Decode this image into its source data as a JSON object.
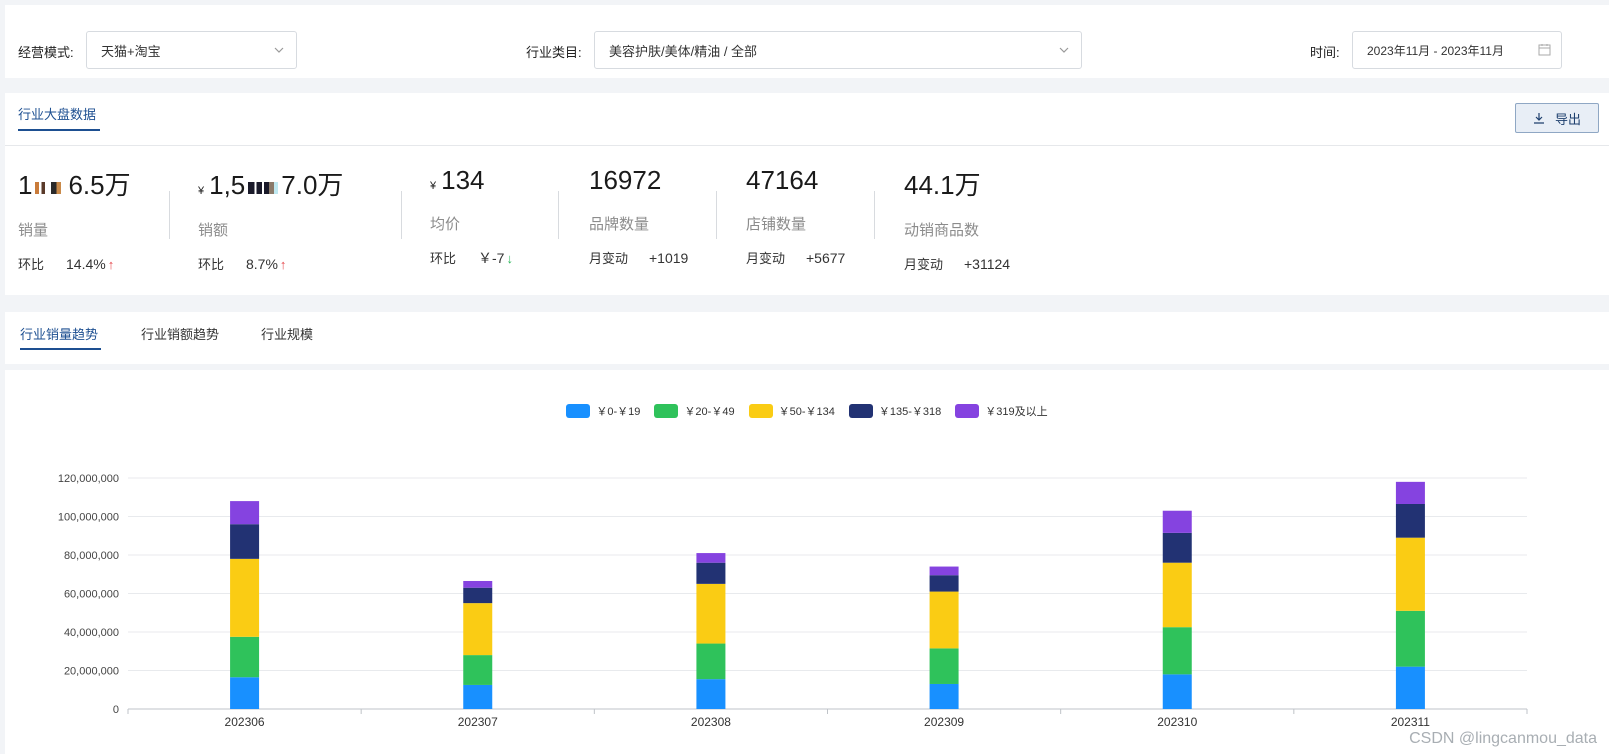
{
  "filters": {
    "mode_label": "经营模式:",
    "mode_value": "天猫+淘宝",
    "category_label": "行业类目:",
    "category_value": "美容护肤/美体/精油 / 全部",
    "time_label": "时间:",
    "time_value": "2023年11月 - 2023年11月"
  },
  "overview": {
    "tab": "行业大盘数据",
    "export_label": "导出",
    "metrics": [
      {
        "value_pre": "1",
        "value_post": "6.5万",
        "name": "销量",
        "sub_key": "环比",
        "sub_val": "14.4%",
        "trend": "up"
      },
      {
        "yen": "¥",
        "value_pre": "1,5",
        "value_post": "7.0万",
        "name": "销额",
        "sub_key": "环比",
        "sub_val": "8.7%",
        "trend": "up"
      },
      {
        "yen": "¥",
        "value": "134",
        "name": "均价",
        "sub_key": "环比",
        "sub_val": "￥-7",
        "trend": "down"
      },
      {
        "value": "16972",
        "name": "品牌数量",
        "sub_key": "月变动",
        "sub_val": "+1019"
      },
      {
        "value": "47164",
        "name": "店铺数量",
        "sub_key": "月变动",
        "sub_val": "+5677"
      },
      {
        "value": "44.1万",
        "name": "动销商品数",
        "sub_key": "月变动",
        "sub_val": "+31124"
      }
    ]
  },
  "trend_tabs": [
    "行业销量趋势",
    "行业销额趋势",
    "行业规模"
  ],
  "icons": {
    "up": "↑",
    "down": "↓"
  },
  "colors": {
    "accent": "#1d4f91",
    "up": "#e5484d",
    "down": "#2eb85c"
  },
  "chart_data": {
    "type": "bar",
    "stacked": true,
    "categories": [
      "202306",
      "202307",
      "202308",
      "202309",
      "202310",
      "202311"
    ],
    "series": [
      {
        "name": "￥0-￥19",
        "color": "#1890ff",
        "values": [
          16500000,
          12500000,
          15500000,
          13000000,
          18000000,
          22000000
        ]
      },
      {
        "name": "￥20-￥49",
        "color": "#2fc25b",
        "values": [
          21000000,
          15500000,
          18500000,
          18500000,
          24500000,
          29000000
        ]
      },
      {
        "name": "￥50-￥134",
        "color": "#facc14",
        "values": [
          40500000,
          27000000,
          31000000,
          29500000,
          33500000,
          38000000
        ]
      },
      {
        "name": "￥135-￥318",
        "color": "#223273",
        "values": [
          18000000,
          8000000,
          11000000,
          8500000,
          15500000,
          17500000
        ]
      },
      {
        "name": "￥319及以上",
        "color": "#8543e0",
        "values": [
          12000000,
          3500000,
          5000000,
          4500000,
          11500000,
          11500000
        ]
      }
    ],
    "ylim": [
      0,
      120000000
    ],
    "yticks": [
      "0",
      "20,000,000",
      "40,000,000",
      "60,000,000",
      "80,000,000",
      "100,000,000",
      "120,000,000"
    ],
    "grid": true,
    "legend": "top-center"
  },
  "watermark": "CSDN @lingcanmou_data"
}
